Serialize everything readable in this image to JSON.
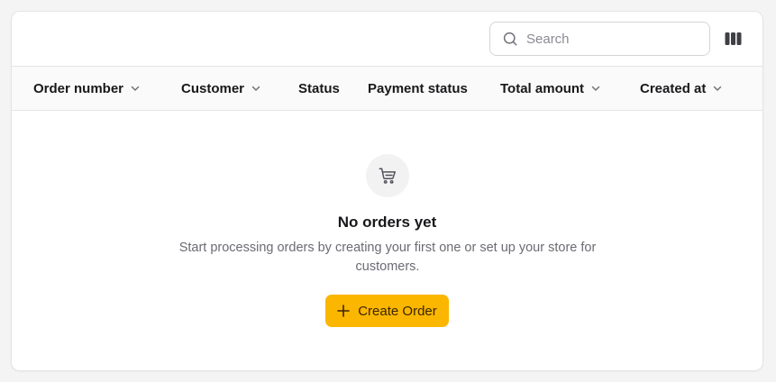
{
  "search": {
    "placeholder": "Search"
  },
  "toolbar": {
    "columns_icon": "columns-icon"
  },
  "table": {
    "columns": [
      {
        "label": "Order number",
        "sortable": true
      },
      {
        "label": "Customer",
        "sortable": true
      },
      {
        "label": "Status",
        "sortable": false
      },
      {
        "label": "Payment status",
        "sortable": false
      },
      {
        "label": "Total amount",
        "sortable": true
      },
      {
        "label": "Created at",
        "sortable": true
      }
    ]
  },
  "empty_state": {
    "icon": "shopping-cart-icon",
    "title": "No orders yet",
    "description": "Start processing orders by creating your first one or set up your store for customers.",
    "button_label": "Create Order",
    "button_icon": "plus-icon"
  },
  "colors": {
    "accent": "#fbb600",
    "border": "#e4e4e7",
    "header_bg": "#fafafa",
    "muted_text": "#6b6b73"
  }
}
